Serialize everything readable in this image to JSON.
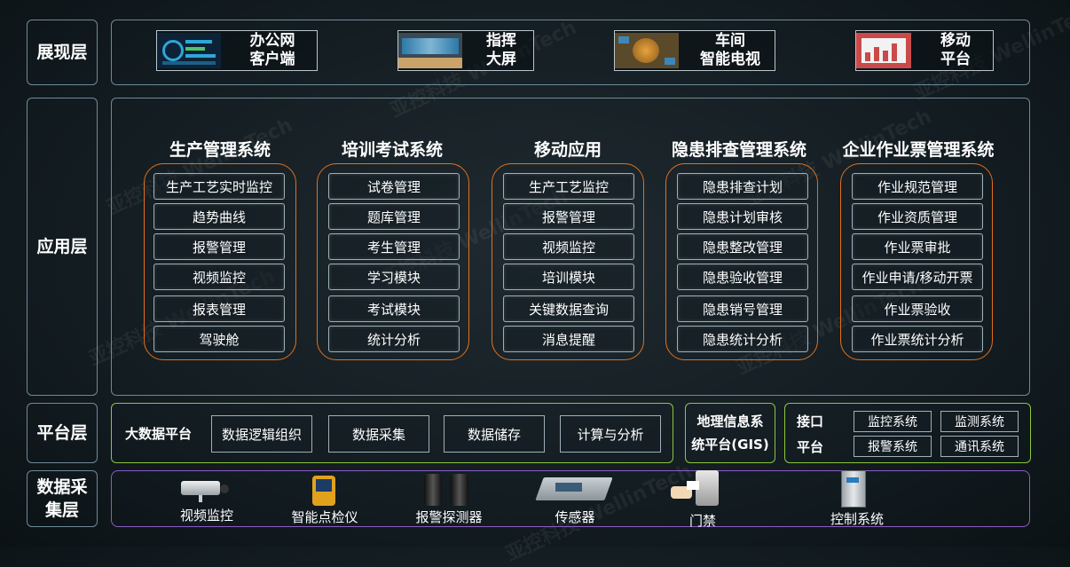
{
  "layers": {
    "presentation": "展现层",
    "application": "应用层",
    "platform": "平台层",
    "collection": "数据采\n集层"
  },
  "presentation_items": [
    {
      "line1": "办公网",
      "line2": "客户端"
    },
    {
      "line1": "指挥",
      "line2": "大屏"
    },
    {
      "line1": "车间",
      "line2": "智能电视"
    },
    {
      "line1": "移动",
      "line2": "平台"
    }
  ],
  "systems": [
    {
      "title": "生产管理系统",
      "items": [
        "生产工艺实时监控",
        "趋势曲线",
        "报警管理",
        "视频监控",
        "报表管理",
        "驾驶舱"
      ]
    },
    {
      "title": "培训考试系统",
      "items": [
        "试卷管理",
        "题库管理",
        "考生管理",
        "学习模块",
        "考试模块",
        "统计分析"
      ]
    },
    {
      "title": "移动应用",
      "items": [
        "生产工艺监控",
        "报警管理",
        "视频监控",
        "培训模块",
        "关键数据查询",
        "消息提醒"
      ]
    },
    {
      "title": "隐患排查管理系统",
      "items": [
        "隐患排查计划",
        "隐患计划审核",
        "隐患整改管理",
        "隐患验收管理",
        "隐患销号管理",
        "隐患统计分析"
      ]
    },
    {
      "title": "企业作业票管理系统",
      "items": [
        "作业规范管理",
        "作业资质管理",
        "作业票审批",
        "作业申请/移动开票",
        "作业票验收",
        "作业票统计分析"
      ]
    }
  ],
  "platform": {
    "bigdata_title": "大数据平台",
    "bigdata_items": [
      "数据逻辑组织",
      "数据采集",
      "数据储存",
      "计算与分析"
    ],
    "gis_line1": "地理信息系",
    "gis_line2": "统平台(GIS)",
    "interface_line1": "接口",
    "interface_line2": "平台",
    "interface_items": [
      "监控系统",
      "监测系统",
      "报警系统",
      "通讯系统"
    ]
  },
  "devices": [
    "视频监控",
    "智能点检仪",
    "报警探测器",
    "传感器",
    "门禁",
    "控制系统"
  ],
  "watermark": "亚控科技 WellinTech"
}
